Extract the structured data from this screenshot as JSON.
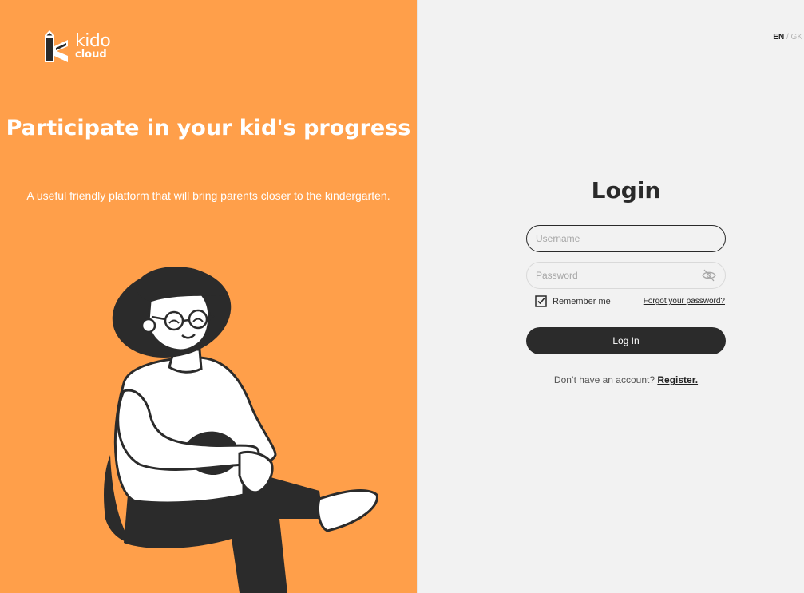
{
  "brand": {
    "name_line1": "kido",
    "name_line2": "cloud",
    "accent_color": "#ff9f4a",
    "icon": "kido-cloud-logo-icon"
  },
  "hero": {
    "title": "Participate in your kid's progress",
    "subtitle": "A useful friendly platform that will bring parents closer to the kindergarten.",
    "illustration": "seated-person-with-hat-illustration"
  },
  "language": {
    "selected": "EN",
    "separator": "/",
    "other": "GK"
  },
  "login": {
    "title": "Login",
    "username_placeholder": "Username",
    "password_placeholder": "Password",
    "password_toggle_icon": "eye-off-icon",
    "remember_me_label": "Remember me",
    "remember_me_checked": true,
    "forgot_password_label": "Forgot your password?",
    "submit_label": "Log In",
    "register_prompt": "Don’t have an account?",
    "register_label": "Register."
  }
}
